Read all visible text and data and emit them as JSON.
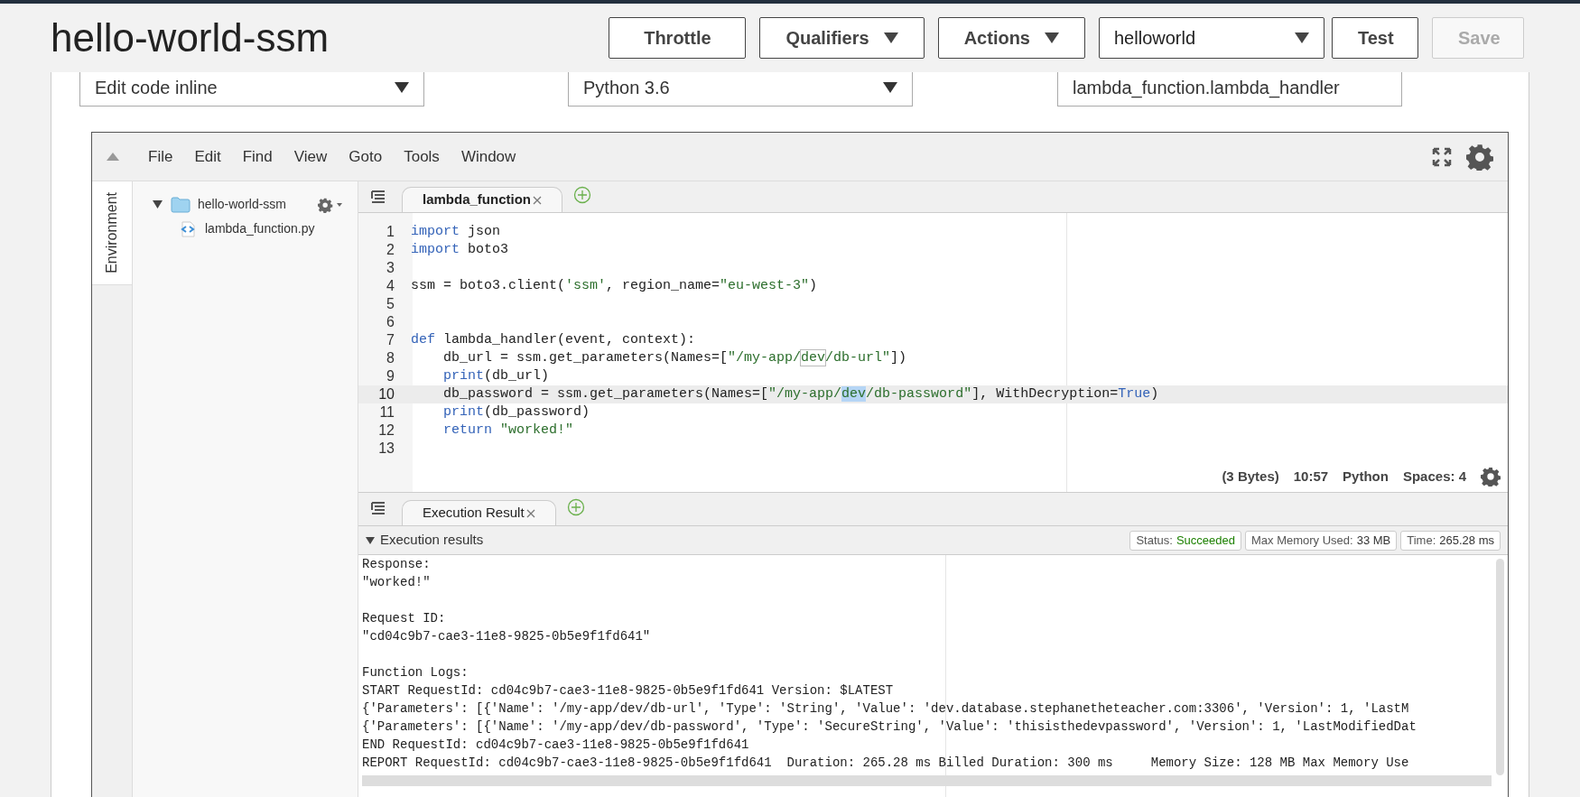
{
  "page_title": "hello-world-ssm",
  "toolbar": [
    {
      "kind": "button",
      "label": "Throttle",
      "disabled": false
    },
    {
      "kind": "menu",
      "label": "Qualifiers"
    },
    {
      "kind": "menu",
      "label": "Actions"
    },
    {
      "kind": "select",
      "label": "helloworld"
    },
    {
      "kind": "button",
      "label": "Test",
      "disabled": false
    },
    {
      "kind": "button",
      "label": "Save",
      "disabled": true
    }
  ],
  "config": {
    "code_entry_type": "Edit code inline",
    "runtime": "Python 3.6",
    "handler": "lambda_function.lambda_handler"
  },
  "ide": {
    "menu": [
      "File",
      "Edit",
      "Find",
      "View",
      "Goto",
      "Tools",
      "Window"
    ],
    "side_tab": "Environment",
    "file_tree": [
      {
        "name": "hello-world-ssm",
        "kind": "folder",
        "expanded": true,
        "children": [
          {
            "name": "lambda_function.py",
            "kind": "file"
          }
        ]
      }
    ],
    "editor_tabs": [
      {
        "label": "lambda_function",
        "selected": true
      }
    ],
    "code_lines": [
      {
        "number": "1",
        "highlighted": false,
        "tokens": [
          {
            "kind": "keyword",
            "text": "import"
          },
          {
            "kind": "plain",
            "text": " json"
          }
        ]
      },
      {
        "number": "2",
        "highlighted": false,
        "tokens": [
          {
            "kind": "keyword",
            "text": "import"
          },
          {
            "kind": "plain",
            "text": " boto3"
          }
        ]
      },
      {
        "number": "3",
        "highlighted": false
      },
      {
        "number": "4",
        "highlighted": false,
        "tokens": [
          {
            "kind": "plain",
            "text": "ssm = boto3.client("
          },
          {
            "kind": "string",
            "text": "'ssm'"
          },
          {
            "kind": "plain",
            "text": ", region_name="
          },
          {
            "kind": "string",
            "text": "\"eu-west-3\""
          },
          {
            "kind": "plain",
            "text": ")"
          }
        ]
      },
      {
        "number": "5",
        "highlighted": false
      },
      {
        "number": "6",
        "highlighted": false
      },
      {
        "number": "7",
        "highlighted": false,
        "tokens": [
          {
            "kind": "keyword",
            "text": "def"
          },
          {
            "kind": "plain",
            "text": " lambda_handler(event, context):"
          }
        ]
      },
      {
        "number": "8",
        "highlighted": false,
        "tokens": [
          {
            "kind": "plain",
            "text": "    db_url = ssm.get_parameters(Names=["
          },
          {
            "kind": "string",
            "text": "\"/my-app/"
          },
          {
            "kind": "match",
            "text": "dev"
          },
          {
            "kind": "string",
            "text": "/db-url\""
          },
          {
            "kind": "plain",
            "text": "])"
          }
        ]
      },
      {
        "number": "9",
        "highlighted": false,
        "tokens": [
          {
            "kind": "builtin",
            "text": "    print"
          },
          {
            "kind": "plain",
            "text": "(db_url)"
          }
        ]
      },
      {
        "number": "10",
        "highlighted": true,
        "tokens": [
          {
            "kind": "plain",
            "text": "    db_password = ssm.get_parameters(Names=["
          },
          {
            "kind": "string",
            "text": "\"/my-app/"
          },
          {
            "kind": "selection",
            "text": "dev"
          },
          {
            "kind": "string",
            "text": "/db-password\""
          },
          {
            "kind": "plain",
            "text": "], WithDecryption="
          },
          {
            "kind": "keyword",
            "text": "True"
          },
          {
            "kind": "plain",
            "text": ")"
          }
        ]
      },
      {
        "number": "11",
        "highlighted": false,
        "tokens": [
          {
            "kind": "builtin",
            "text": "    print"
          },
          {
            "kind": "plain",
            "text": "(db_password)"
          }
        ]
      },
      {
        "number": "12",
        "highlighted": false,
        "tokens": [
          {
            "kind": "keyword",
            "text": "    return"
          },
          {
            "kind": "string",
            "text": " \"worked!\""
          }
        ]
      },
      {
        "number": "13",
        "highlighted": false
      }
    ],
    "editor_status": [
      "(3 Bytes)",
      "10:57",
      "Python",
      "Spaces: 4"
    ],
    "result_tabs": [
      {
        "label": "Execution Result",
        "selected": true
      }
    ],
    "results": {
      "title": "Execution results",
      "expanded": true,
      "badges": [
        {
          "label": "Status:",
          "value": "Succeeded",
          "kind": "success"
        },
        {
          "label": "Max Memory Used:",
          "value": "33 MB",
          "kind": "plain"
        },
        {
          "label": "Time:",
          "value": "265.28 ms",
          "kind": "plain"
        }
      ],
      "output_blocks": [
        [
          "Response:",
          "\"worked!\""
        ],
        [
          "Request ID:",
          "\"cd04c9b7-cae3-11e8-9825-0b5e9f1fd641\""
        ],
        [
          "Function Logs:",
          "START RequestId: cd04c9b7-cae3-11e8-9825-0b5e9f1fd641 Version: $LATEST",
          "{'Parameters': [{'Name': '/my-app/dev/db-url', 'Type': 'String', 'Value': 'dev.database.stephanetheteacher.com:3306', 'Version': 1, 'LastM",
          "{'Parameters': [{'Name': '/my-app/dev/db-password', 'Type': 'SecureString', 'Value': 'thisisthedevpassword', 'Version': 1, 'LastModifiedDat",
          "END RequestId: cd04c9b7-cae3-11e8-9825-0b5e9f1fd641",
          "REPORT RequestId: cd04c9b7-cae3-11e8-9825-0b5e9f1fd641  Duration: 265.28 ms Billed Duration: 300 ms     Memory Size: 128 MB Max Memory Use"
        ]
      ]
    }
  }
}
